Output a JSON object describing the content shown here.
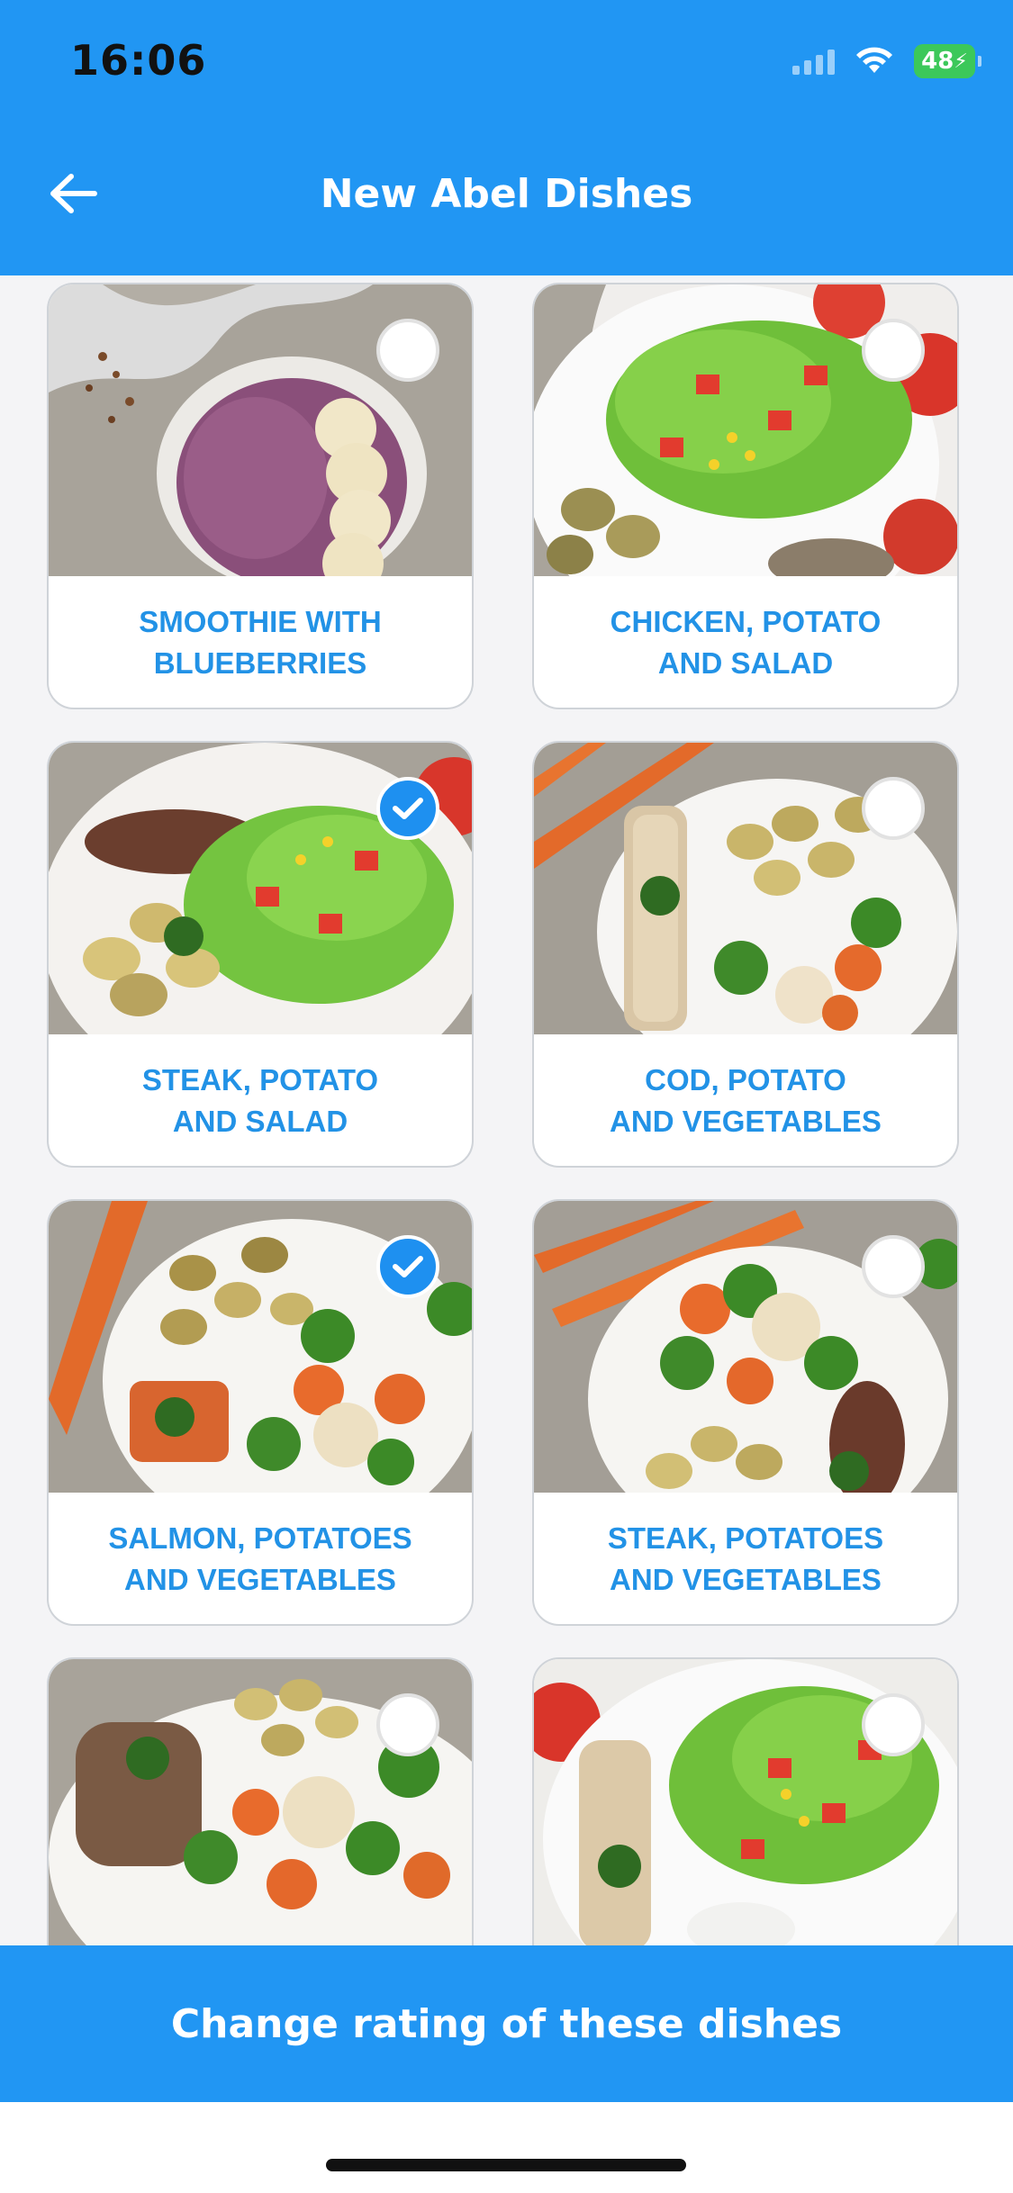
{
  "status_bar": {
    "time": "16:06",
    "battery": "48"
  },
  "header": {
    "title": "New Abel Dishes",
    "back_icon": "arrow-left-icon"
  },
  "dishes": [
    {
      "name": "SMOOTHIE WITH\nBLUEBERRIES",
      "selected": false
    },
    {
      "name": "CHICKEN, POTATO\nAND SALAD",
      "selected": false
    },
    {
      "name": "STEAK, POTATO\nAND SALAD",
      "selected": true
    },
    {
      "name": "COD, POTATO\nAND VEGETABLES",
      "selected": false
    },
    {
      "name": "SALMON, POTATOES\nAND VEGETABLES",
      "selected": true
    },
    {
      "name": "STEAK, POTATOES\nAND VEGETABLES",
      "selected": false
    },
    {
      "name": "",
      "selected": false
    },
    {
      "name": "",
      "selected": false
    }
  ],
  "footer": {
    "cta_label": "Change rating of these dishes"
  },
  "colors": {
    "primary": "#2196f3",
    "label_text": "#2292e6",
    "check_on": "#1e90f0"
  }
}
